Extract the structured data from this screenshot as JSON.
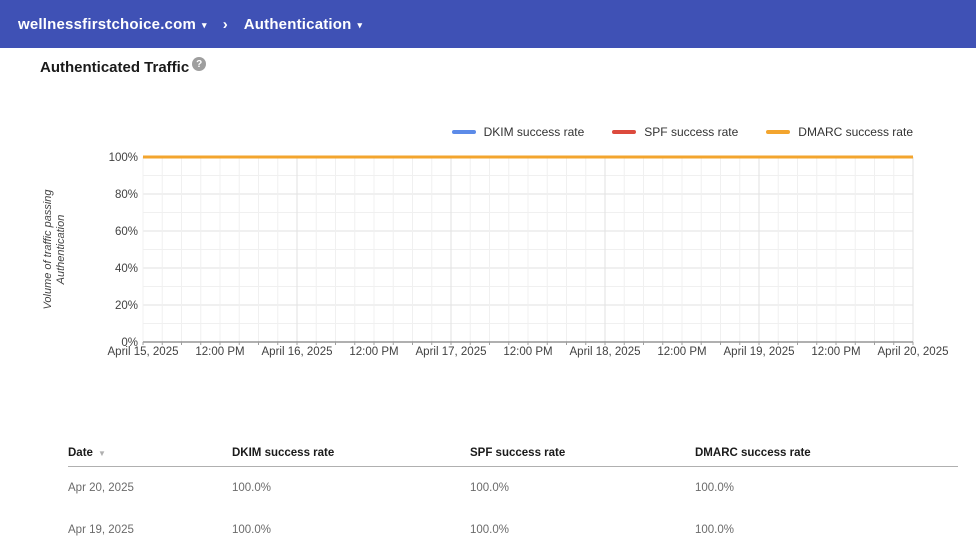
{
  "topbar": {
    "domain_label": "wellnessfirstchoice.com",
    "section_label": "Authentication",
    "separator": "›",
    "caret": "▾"
  },
  "page": {
    "title": "Authenticated Traffic",
    "help": "?"
  },
  "colors": {
    "topbar_bg": "#3F51B5",
    "dkim": "#5C8BE8",
    "spf": "#DC4A3D",
    "dmarc": "#F3A52E",
    "grid_minor": "#f0f0f0",
    "grid_major": "#e2e2e2",
    "axis_line": "#616161"
  },
  "legend": {
    "items": [
      {
        "label": "DKIM success rate",
        "color": "#5C8BE8"
      },
      {
        "label": "SPF success rate",
        "color": "#DC4A3D"
      },
      {
        "label": "DMARC success rate",
        "color": "#F3A52E"
      }
    ]
  },
  "chart_data": {
    "type": "line",
    "title": "Authenticated Traffic",
    "ylabel": "Volume of traffic passing Authentication",
    "ylabel_lines": [
      "Volume of traffic passing",
      "Authentication"
    ],
    "x": [
      "April 15, 2025",
      "April 16, 2025",
      "April 17, 2025",
      "April 18, 2025",
      "April 19, 2025",
      "April 20, 2025"
    ],
    "xticklabels": [
      "April 15, 2025",
      "12:00 PM",
      "April 16, 2025",
      "12:00 PM",
      "April 17, 2025",
      "12:00 PM",
      "April 18, 2025",
      "12:00 PM",
      "April 19, 2025",
      "12:00 PM",
      "April 20, 2025"
    ],
    "yticklabels": [
      "0%",
      "20%",
      "40%",
      "60%",
      "80%",
      "100%"
    ],
    "ytick_values": [
      0,
      20,
      40,
      60,
      80,
      100
    ],
    "ylim": [
      0,
      100
    ],
    "grid": true,
    "legend_position": "top-right",
    "series": [
      {
        "name": "DKIM success rate",
        "color": "#5C8BE8",
        "values": [
          100,
          100,
          100,
          100,
          100,
          100
        ]
      },
      {
        "name": "SPF success rate",
        "color": "#DC4A3D",
        "values": [
          100,
          100,
          100,
          100,
          100,
          100
        ]
      },
      {
        "name": "DMARC success rate",
        "color": "#F3A52E",
        "values": [
          100,
          100,
          100,
          100,
          100,
          100
        ]
      }
    ]
  },
  "table": {
    "columns": [
      {
        "label": "Date",
        "sort_icon": "▼"
      },
      {
        "label": "DKIM success rate"
      },
      {
        "label": "SPF success rate"
      },
      {
        "label": "DMARC success rate"
      }
    ],
    "rows": [
      {
        "date": "Apr 20, 2025",
        "dkim": "100.0%",
        "spf": "100.0%",
        "dmarc": "100.0%"
      },
      {
        "date": "Apr 19, 2025",
        "dkim": "100.0%",
        "spf": "100.0%",
        "dmarc": "100.0%"
      }
    ]
  }
}
